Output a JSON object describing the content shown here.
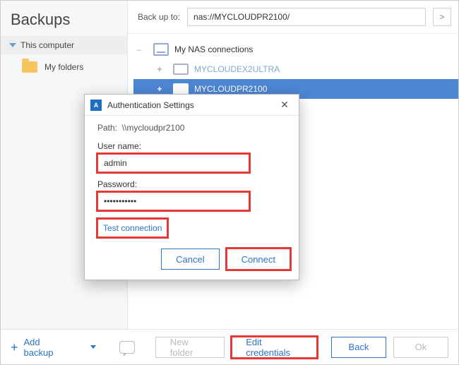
{
  "sidebar": {
    "title": "Backups",
    "section": "This computer",
    "items": [
      {
        "label": "My folders"
      }
    ]
  },
  "header": {
    "label": "Back up to:",
    "path": "nas://MYCLOUDPR2100/",
    "expand_glyph": ">"
  },
  "tree": {
    "root_label": "My NAS connections",
    "items": [
      {
        "label": "MYCLOUDEX2ULTRA"
      },
      {
        "label": "MYCLOUDPR2100"
      }
    ]
  },
  "dialog": {
    "title": "Authentication Settings",
    "path_prefix": "Path:",
    "path": "\\\\mycloudpr2100",
    "username_label": "User name:",
    "username": "admin",
    "password_label": "Password:",
    "password_mask": "•••••••••••",
    "test_link": "Test connection",
    "cancel": "Cancel",
    "connect": "Connect"
  },
  "footer": {
    "add_backup": "Add backup",
    "new_folder": "New folder",
    "edit_credentials": "Edit credentials",
    "back": "Back",
    "ok": "Ok"
  }
}
